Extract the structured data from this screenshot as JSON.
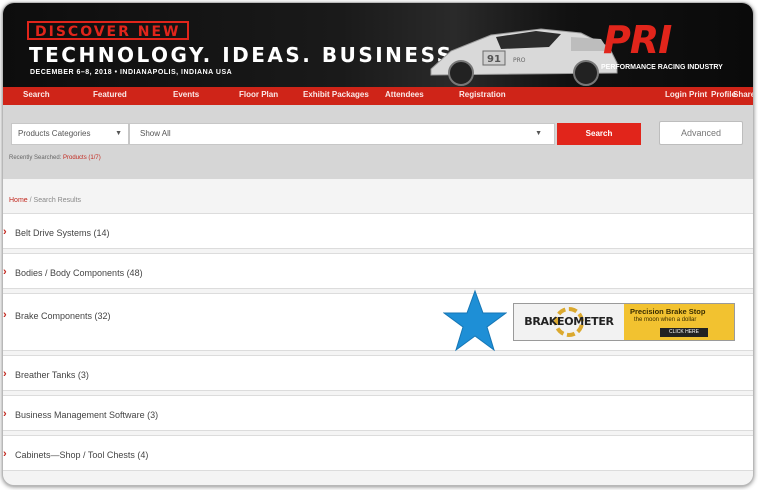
{
  "banner": {
    "discover": "DISCOVER NEW",
    "headline": "TECHNOLOGY. IDEAS. BUSINESS.",
    "event_details": "DECEMBER 6–8, 2018  •  INDIANAPOLIS, INDIANA USA",
    "logo_text": "PRI",
    "logo_tagline": "PERFORMANCE RACING INDUSTRY",
    "car_number": "91",
    "car_plate": "PRO"
  },
  "nav": {
    "items": [
      "Search",
      "Featured",
      "Events",
      "Floor Plan",
      "Exhibit Packages",
      "Attendees",
      "Registration"
    ],
    "right_items": [
      "Login",
      "Print",
      "Profile",
      "Share"
    ]
  },
  "search": {
    "category_value": "Products Categories",
    "keyword_value": "Show All",
    "search_label": "Search",
    "advanced_label": "Advanced",
    "recent_label": "Recently Searched:",
    "recent_link": "Products (1/7)"
  },
  "breadcrumb": {
    "home": "Home",
    "separator": "/",
    "current": "Search Results"
  },
  "categories": [
    {
      "label": "Belt Drive Systems (14)"
    },
    {
      "label": "Bodies / Body Components (48)"
    },
    {
      "label": "Brake Components (32)"
    },
    {
      "label": "Breather Tanks (3)"
    },
    {
      "label": "Business Management Software (3)"
    },
    {
      "label": "Cabinets—Shop / Tool Chests (4)"
    }
  ],
  "ad": {
    "brand": "BRAKEOMETER",
    "headline": "Precision Brake Stop",
    "subline": "the moon when a dollar",
    "cta": "CLICK HERE"
  },
  "colors": {
    "accent_red": "#e1251b",
    "nav_red": "#cf2418",
    "banner_black": "#111111",
    "ad_yellow": "#f2c230",
    "star_blue": "#1e8fd6"
  }
}
